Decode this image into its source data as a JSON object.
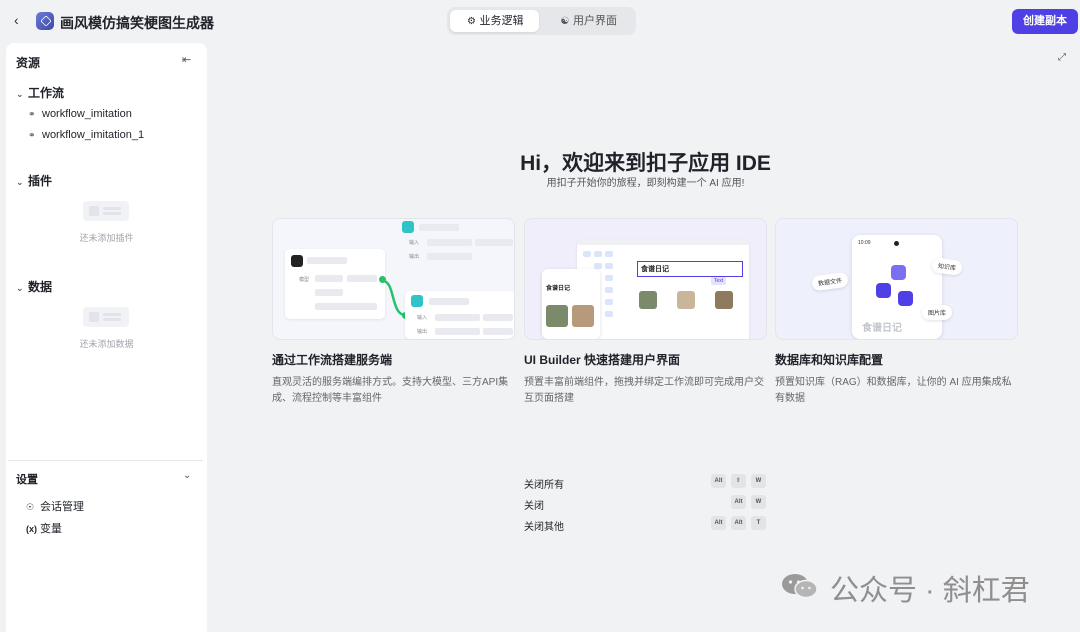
{
  "header": {
    "back_icon": "chevron-left-icon",
    "app_title": "画风模仿搞笑梗图生成器",
    "tabs": [
      {
        "label": "业务逻辑",
        "icon": "workflow-icon",
        "active": true
      },
      {
        "label": "用户界面",
        "icon": "palette-icon",
        "active": false
      }
    ],
    "copy_button": "创建副本",
    "accent_color": "#4e40e5"
  },
  "sidebar": {
    "title": "资源",
    "workflow_section": {
      "title": "工作流",
      "items": [
        "workflow_imitation",
        "workflow_imitation_1"
      ]
    },
    "plugin_section": {
      "title": "插件",
      "empty_text": "还未添加插件"
    },
    "data_section": {
      "title": "数据",
      "empty_text": "还未添加数据"
    },
    "settings": {
      "title": "设置",
      "items": [
        {
          "label": "会话管理",
          "icon": "chat-icon"
        },
        {
          "label": "变量",
          "icon": "variable-icon"
        }
      ]
    }
  },
  "main": {
    "welcome_title": "Hi，欢迎来到扣子应用 IDE",
    "welcome_subtitle": "用扣子开始你的旅程，即刻构建一个 AI 应用!",
    "cards": [
      {
        "title": "通过工作流搭建服务端",
        "description": "直观灵活的服务端编排方式。支持大模型、三方API集成、流程控制等丰富组件",
        "illustration": {
          "labels": [
            "输入",
            "输出",
            "模型",
            "输入",
            "输出"
          ]
        }
      },
      {
        "title": "UI Builder 快速搭建用户界面",
        "description": "预置丰富前端组件，拖拽并绑定工作流即可完成用户交互页面搭建",
        "illustration": {
          "labels": [
            "食谱日记",
            "食谱日记",
            "Text"
          ]
        }
      },
      {
        "title": "数据库和知识库配置",
        "description": "预置知识库（RAG）和数据库，让你的 AI 应用集成私有数据",
        "illustration": {
          "labels": [
            "数据文件",
            "知识库",
            "图片库",
            "食谱日记",
            "10:09"
          ]
        }
      }
    ],
    "shortcuts": [
      {
        "label": "关闭所有",
        "keys": [
          "Alt",
          "⇧",
          "W"
        ]
      },
      {
        "label": "关闭",
        "keys": [
          "Alt",
          "W"
        ]
      },
      {
        "label": "关闭其他",
        "keys": [
          "Alt",
          "Alt",
          "T"
        ]
      }
    ]
  },
  "watermark": "公众号 · 斜杠君"
}
